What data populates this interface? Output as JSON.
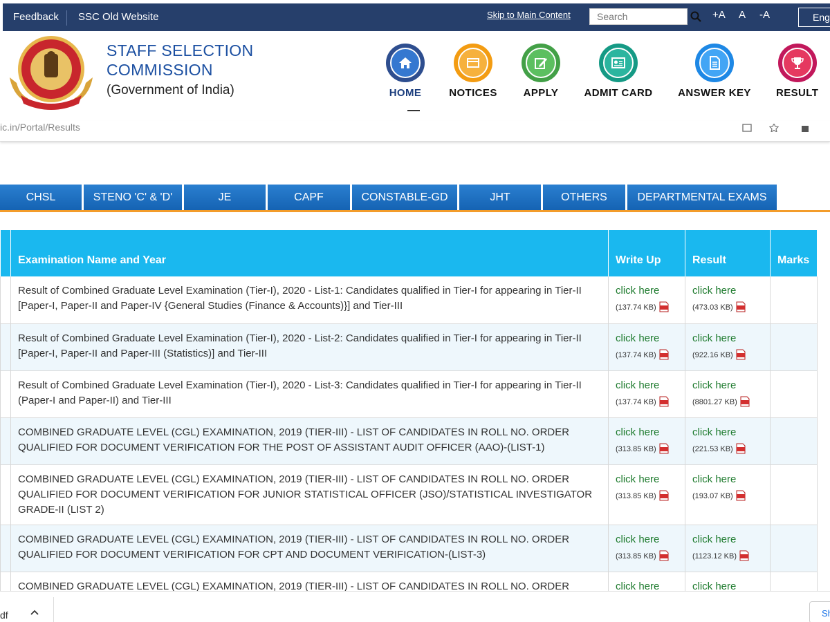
{
  "topbar": {
    "feedback": "Feedback",
    "old_site": "SSC Old Website",
    "skip": "Skip to Main Content",
    "search_placeholder": "Search",
    "font_inc": "+A",
    "font_normal": "A",
    "font_dec": "-A",
    "language": "Engl"
  },
  "header": {
    "org_line1": "STAFF SELECTION",
    "org_line2": "COMMISSION",
    "org_sub": "(Government of India)"
  },
  "nav": [
    {
      "label": "HOME",
      "icon": "home-icon",
      "color": "#2e4e8f",
      "inner": "#3578d0"
    },
    {
      "label": "NOTICES",
      "icon": "notice-icon",
      "color": "#f39c12",
      "inner": "#f6b13d"
    },
    {
      "label": "APPLY",
      "icon": "edit-icon",
      "color": "#43a047",
      "inner": "#5cbf60"
    },
    {
      "label": "ADMIT CARD",
      "icon": "id-card-icon",
      "color": "#159a85",
      "inner": "#2bb59f"
    },
    {
      "label": "ANSWER KEY",
      "icon": "document-icon",
      "color": "#1e88e5",
      "inner": "#42a5f5"
    },
    {
      "label": "RESULT",
      "icon": "trophy-icon",
      "color": "#c2185b",
      "inner": "#e53960"
    }
  ],
  "address": {
    "url": "ic.in/Portal/Results"
  },
  "tabs": [
    "CHSL",
    "STENO 'C' & 'D'",
    "JE",
    "CAPF",
    "CONSTABLE-GD",
    "JHT",
    "OTHERS",
    "DEPARTMENTAL EXAMS"
  ],
  "table": {
    "headers": {
      "name": "Examination Name and Year",
      "writeup": "Write Up",
      "result": "Result",
      "marks": "Marks"
    },
    "link_text": "click here",
    "rows": [
      {
        "name": "Result of Combined Graduate Level Examination (Tier-I), 2020 - List-1: Candidates qualified in Tier-I for appearing in Tier-II [Paper-I, Paper-II and Paper-IV {General Studies (Finance & Accounts)}] and Tier-III",
        "writeup_size": "(137.74 KB)",
        "result_size": "(473.03 KB)"
      },
      {
        "name": "Result of Combined Graduate Level Examination (Tier-I), 2020 - List-2: Candidates qualified in Tier-I for appearing in Tier-II [Paper-I, Paper-II and Paper-III (Statistics)] and Tier-III",
        "writeup_size": "(137.74 KB)",
        "result_size": "(922.16 KB)"
      },
      {
        "name": "Result of Combined Graduate Level Examination (Tier-I), 2020 - List-3: Candidates qualified in Tier-I for appearing in Tier-II (Paper-I and Paper-II) and Tier-III",
        "writeup_size": "(137.74 KB)",
        "result_size": "(8801.27 KB)"
      },
      {
        "name": "COMBINED GRADUATE LEVEL (CGL) EXAMINATION, 2019 (TIER-III) - LIST OF CANDIDATES IN ROLL NO. ORDER QUALIFIED FOR DOCUMENT VERIFICATION FOR THE POST OF ASSISTANT AUDIT OFFICER (AAO)-(LIST-1)",
        "writeup_size": "(313.85 KB)",
        "result_size": "(221.53 KB)"
      },
      {
        "name": "COMBINED GRADUATE LEVEL (CGL) EXAMINATION, 2019 (TIER-III) - LIST OF CANDIDATES IN ROLL NO. ORDER QUALIFIED FOR DOCUMENT VERIFICATION FOR JUNIOR STATISTICAL OFFICER (JSO)/STATISTICAL INVESTIGATOR GRADE-II (LIST 2)",
        "writeup_size": "(313.85 KB)",
        "result_size": "(193.07 KB)"
      },
      {
        "name": "COMBINED GRADUATE LEVEL (CGL) EXAMINATION, 2019 (TIER-III) - LIST OF CANDIDATES IN ROLL NO. ORDER QUALIFIED FOR DOCUMENT VERIFICATION FOR CPT AND DOCUMENT VERIFICATION-(LIST-3)",
        "writeup_size": "(313.85 KB)",
        "result_size": "(1123.12 KB)"
      },
      {
        "name": "COMBINED GRADUATE LEVEL (CGL) EXAMINATION, 2019 (TIER-III) - LIST OF CANDIDATES IN ROLL NO. ORDER",
        "writeup_size": "",
        "result_size": ""
      }
    ]
  },
  "download_bar": {
    "filename": "df",
    "show_all": "Sh"
  }
}
